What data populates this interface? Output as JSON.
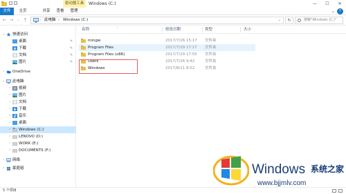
{
  "window": {
    "title": "Windows (C:)",
    "context_tab": "驱动器工具",
    "controls": {
      "minimize": "—",
      "maximize": "☐",
      "close": "✕"
    }
  },
  "ribbon": {
    "tabs": [
      "文件",
      "主页",
      "共享",
      "查看",
      "管理"
    ],
    "help": "?",
    "collapse": "⌄"
  },
  "address": {
    "crumbs": [
      "此电脑",
      "Windows (C:)"
    ],
    "search_placeholder": "搜索\"Windows (C:)\""
  },
  "nav": {
    "quick_access": "快速访问",
    "quick_items": [
      "桌面",
      "下载",
      "文档",
      "图片"
    ],
    "onedrive": "OneDrive",
    "this_pc": "此电脑",
    "pc_items": [
      "视频",
      "图片",
      "文档",
      "下载",
      "音乐",
      "桌面"
    ],
    "drives": [
      "Windows (C:)",
      "LENOVO (D:)",
      "WORK (E:)",
      "DOCUMENTS (F:)"
    ],
    "network": "网络",
    "homegroup": "家庭组"
  },
  "columns": {
    "name": "名称",
    "date": "修改日期",
    "type": "类型",
    "size": "大小"
  },
  "files": [
    {
      "name": "mingw",
      "date": "2017/7/26 15:17",
      "type": "文件夹"
    },
    {
      "name": "Program Files",
      "date": "2017/7/29 17:17",
      "type": "文件夹"
    },
    {
      "name": "Program Files (x86)",
      "date": "2017/7/29 17:55",
      "type": "文件夹"
    },
    {
      "name": "Users",
      "date": "2017/7/26 9:42",
      "type": "文件夹"
    },
    {
      "name": "Windows",
      "date": "2017/8/11 8:52",
      "type": "文件夹"
    }
  ],
  "status": {
    "item_count": "5 个项目"
  },
  "watermark": {
    "brand": "Windows",
    "cn": "系统之家",
    "url": "www.bjjmlv.com"
  },
  "colors": {
    "accent": "#1979ca",
    "selection": "#cce8ff",
    "folder": "#e8c04a",
    "highlight_box": "#e85a5a"
  }
}
